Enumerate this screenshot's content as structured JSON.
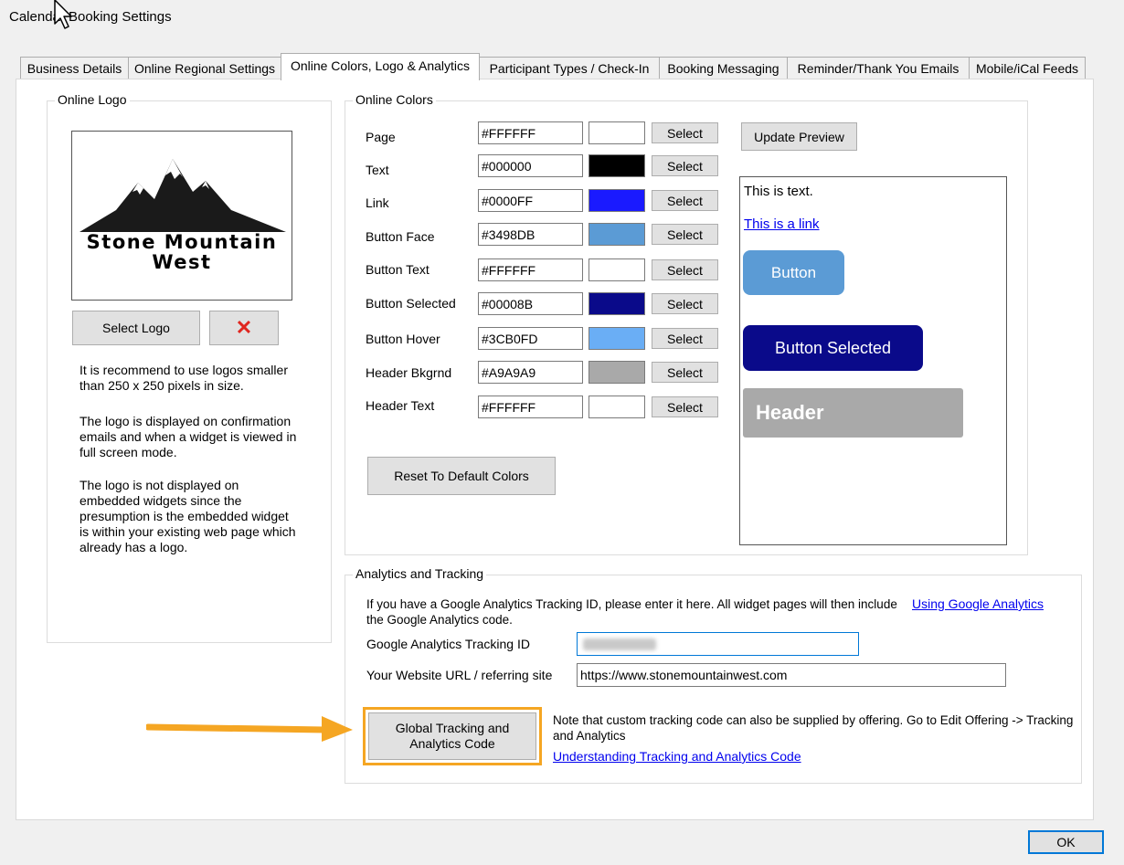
{
  "window": {
    "title": "Calendar Booking Settings"
  },
  "tabs": [
    {
      "label": "Business Details",
      "active": false
    },
    {
      "label": "Online Regional Settings",
      "active": false
    },
    {
      "label": "Online Colors, Logo & Analytics",
      "active": true
    },
    {
      "label": "Participant Types / Check-In",
      "active": false
    },
    {
      "label": "Booking Messaging",
      "active": false
    },
    {
      "label": "Reminder/Thank You Emails",
      "active": false
    },
    {
      "label": "Mobile/iCal Feeds",
      "active": false
    }
  ],
  "logo_group": {
    "legend": "Online Logo",
    "logo_line1": "Stone Mountain",
    "logo_line2": "West",
    "select_label": "Select Logo",
    "delete_glyph": "✕",
    "help1": "It is recommend to use logos smaller than 250 x 250 pixels in size.",
    "help2": "The logo is displayed on confirmation emails and when a widget is viewed in full screen mode.",
    "help3": "The logo is not displayed on embedded widgets since the presumption is the embedded widget is within your existing web page which already has a logo."
  },
  "colors_group": {
    "legend": "Online Colors",
    "select_label": "Select",
    "rows": [
      {
        "label": "Page",
        "value": "#FFFFFF"
      },
      {
        "label": "Text",
        "value": "#000000"
      },
      {
        "label": "Link",
        "value": "#0000FF"
      },
      {
        "label": "Button Face",
        "value": "#3498DB"
      },
      {
        "label": "Button Text",
        "value": "#FFFFFF"
      },
      {
        "label": "Button Selected",
        "value": "#00008B"
      },
      {
        "label": "Button Hover",
        "value": "#3CB0FD"
      },
      {
        "label": "Header Bkgrnd",
        "value": "#A9A9A9"
      },
      {
        "label": "Header Text",
        "value": "#FFFFFF"
      }
    ],
    "swatches": [
      "#ffffff",
      "#000000",
      "#1a1aff",
      "#5b9bd5",
      "#ffffff",
      "#0a0a8a",
      "#6aaef5",
      "#a9a9a9",
      "#ffffff"
    ],
    "update_label": "Update Preview",
    "reset_label": "Reset To Default Colors"
  },
  "preview": {
    "text": "This is text.",
    "link": "This is a link",
    "button": "Button",
    "button_selected": "Button Selected",
    "header": "Header"
  },
  "analytics_group": {
    "legend": "Analytics and Tracking",
    "intro": "If you have a Google Analytics Tracking ID, please enter it here.  All widget pages will then include the Google Analytics code.",
    "ga_link": "Using Google Analytics",
    "ga_label": "Google Analytics Tracking ID",
    "ga_value": "",
    "url_label": "Your Website URL / referring site",
    "url_value": "https://www.stonemountainwest.com",
    "global_button": "Global Tracking and Analytics Code",
    "note": "Note that custom tracking code can also be supplied by offering.  Go to Edit Offering -> Tracking and Analytics",
    "understand_link": "Understanding Tracking and Analytics Code"
  },
  "footer": {
    "ok_label": "OK"
  },
  "colors": {
    "highlight": "#f5a623",
    "focus": "#0078d7"
  }
}
